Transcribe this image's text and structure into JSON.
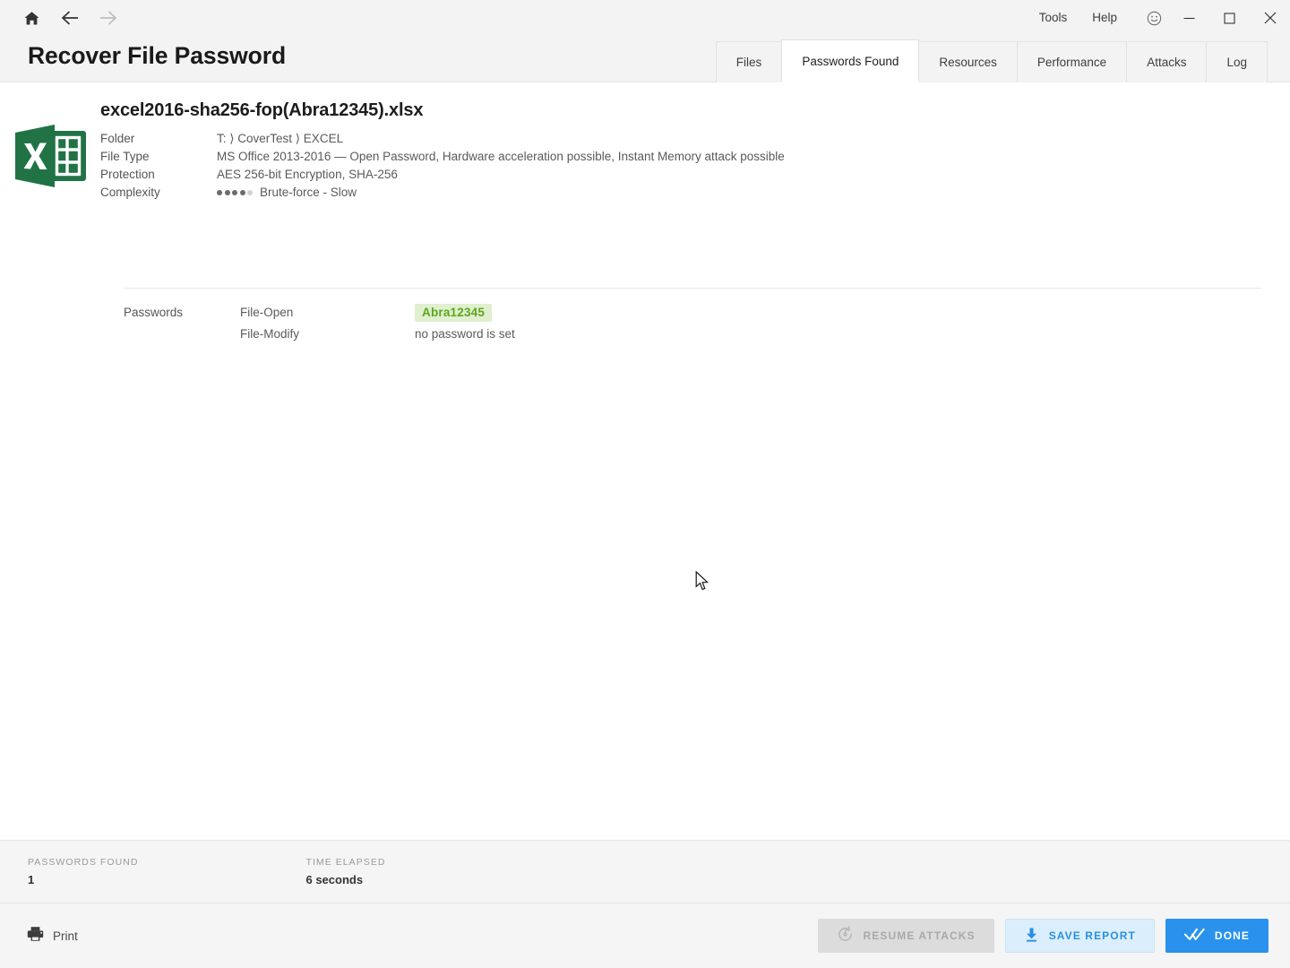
{
  "window": {
    "title": "Recover File Password",
    "nav": {
      "home_icon": "home-icon",
      "back_icon": "arrow-left-icon",
      "forward_icon": "arrow-right-icon"
    },
    "menus": [
      {
        "label": "Tools",
        "name": "menu-tools"
      },
      {
        "label": "Help",
        "name": "menu-help"
      }
    ],
    "feedback_icon": "smiley-face-icon",
    "controls": {
      "minimize_icon": "minimize-icon",
      "maximize_icon": "maximize-icon",
      "close_icon": "close-icon"
    }
  },
  "tabs": [
    {
      "label": "Files",
      "active": false
    },
    {
      "label": "Passwords Found",
      "active": true
    },
    {
      "label": "Resources",
      "active": false
    },
    {
      "label": "Performance",
      "active": false
    },
    {
      "label": "Attacks",
      "active": false
    },
    {
      "label": "Log",
      "active": false
    }
  ],
  "file": {
    "icon": "excel-file-icon",
    "name": "excel2016-sha256-fop(Abra12345).xlsx",
    "meta": [
      {
        "label": "Folder",
        "value": "T: ⟩ CoverTest ⟩ EXCEL"
      },
      {
        "label": "File Type",
        "value": "MS Office 2013-2016 — Open Password, Hardware acceleration possible, Instant Memory attack possible"
      },
      {
        "label": "Protection",
        "value": "AES 256-bit Encryption, SHA-256"
      }
    ],
    "complexity": {
      "label": "Complexity",
      "value": "Brute-force - Slow",
      "filled_dots": 4,
      "total_dots": 5
    }
  },
  "passwords": {
    "section_label": "Passwords",
    "rows": [
      {
        "kind": "File-Open",
        "value": "Abra12345",
        "is_badge": true
      },
      {
        "kind": "File-Modify",
        "value": "no password is set",
        "is_badge": false
      }
    ],
    "badge_bg": "#e0f0cf",
    "badge_text_color": "#5fa520"
  },
  "status": {
    "passwords_found_label": "PASSWORDS FOUND",
    "passwords_found_value": "1",
    "time_elapsed_label": "TIME ELAPSED",
    "time_elapsed_value": "6 seconds"
  },
  "footer": {
    "print": {
      "label": "Print",
      "icon": "printer-icon"
    },
    "resume": {
      "label": "RESUME ATTACKS",
      "icon": "resume-circle-icon",
      "disabled": true
    },
    "save": {
      "label": "SAVE REPORT",
      "icon": "download-icon"
    },
    "done": {
      "label": "DONE",
      "icon": "double-check-icon"
    }
  },
  "theme": {
    "accent": "#2a92ec",
    "header_bg": "#f3f3f3",
    "footer_bg": "#f5f5f5",
    "excel_green": "#217346"
  }
}
